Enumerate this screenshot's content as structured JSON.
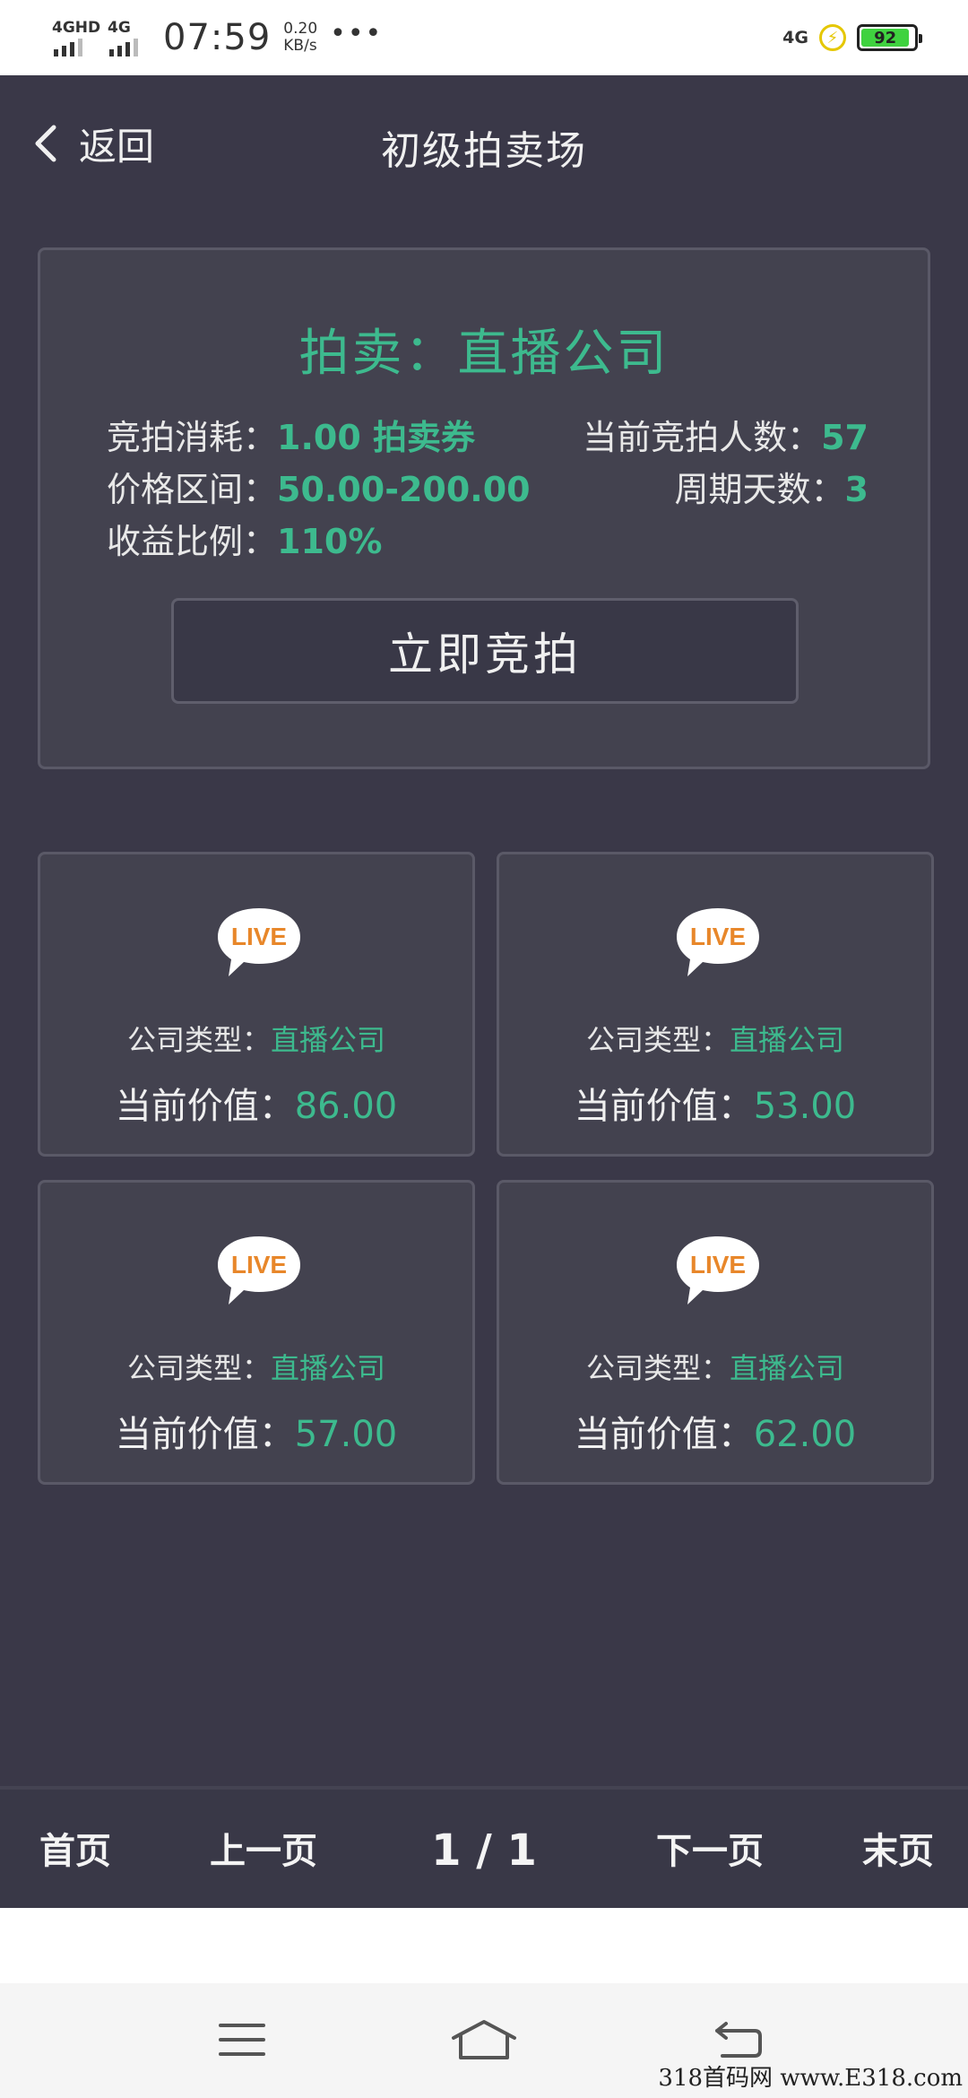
{
  "status_bar": {
    "sim1_label": "4GHD",
    "sim2_label": "4G",
    "time": "07:59",
    "speed_value": "0.20",
    "speed_unit": "KB/s",
    "more": "•••",
    "network": "4G",
    "battery_level": "92",
    "battery_fraction": 0.92,
    "charging": true
  },
  "header": {
    "back_label": "返回",
    "title": "初级拍卖场"
  },
  "auction": {
    "title": "拍卖：直播公司",
    "cost_label": "竞拍消耗：",
    "cost_value": "1.00 拍卖券",
    "bidders_label": "当前竞拍人数：",
    "bidders_value": "57",
    "price_range_label": "价格区间：",
    "price_range_value": "50.00-200.00",
    "cycle_label": "周期天数：",
    "cycle_value": "3",
    "yield_label": "收益比例：",
    "yield_value": "110%",
    "bid_button": "立即竞拍"
  },
  "companies": [
    {
      "icon_text": "LIVE",
      "type_label": "公司类型：",
      "type_value": "直播公司",
      "value_label": "当前价值：",
      "value": "86.00"
    },
    {
      "icon_text": "LIVE",
      "type_label": "公司类型：",
      "type_value": "直播公司",
      "value_label": "当前价值：",
      "value": "53.00"
    },
    {
      "icon_text": "LIVE",
      "type_label": "公司类型：",
      "type_value": "直播公司",
      "value_label": "当前价值：",
      "value": "57.00"
    },
    {
      "icon_text": "LIVE",
      "type_label": "公司类型：",
      "type_value": "直播公司",
      "value_label": "当前价值：",
      "value": "62.00"
    }
  ],
  "pagination": {
    "first": "首页",
    "prev": "上一页",
    "current": "1 / 1",
    "next": "下一页",
    "last": "末页"
  },
  "watermark": "318首码网 www.E318.com",
  "colors": {
    "accent": "#3dba8e",
    "background": "#3a3848",
    "card": "#43424f",
    "live_icon": "#e8872a"
  }
}
